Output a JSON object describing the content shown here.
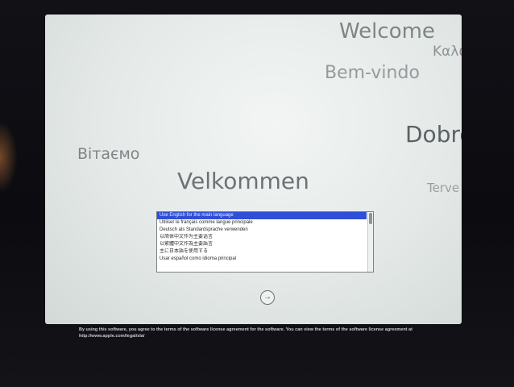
{
  "welcome_words": {
    "welcome": "Welcome",
    "greek": "Καλώ",
    "portuguese": "Bem-vindo",
    "croatian": "Dobro",
    "belarusian": "Вітаємо",
    "norwegian": "Velkommen",
    "finnish": "Terve"
  },
  "language_list": {
    "items": [
      {
        "label": "Use English for the main language",
        "selected": true
      },
      {
        "label": "Utiliser le français comme langue principale",
        "selected": false
      },
      {
        "label": "Deutsch als Standardsprache verwenden",
        "selected": false
      },
      {
        "label": "以简体中文作为主要语言",
        "selected": false
      },
      {
        "label": "以繁體中文作為主要語言",
        "selected": false
      },
      {
        "label": "主に日本語を使用する",
        "selected": false
      },
      {
        "label": "Usar español como idioma principal",
        "selected": false
      }
    ]
  },
  "continue_icon": "→",
  "license": {
    "text": "By using this software, you agree to the terms of the software license agreement for the software. You can view the terms of the software license agreement at",
    "link": "http://www.apple.com/legal/sla/"
  },
  "colors": {
    "selection": "#2f4fd6",
    "screen_background": "#e4e9e7",
    "bezel": "#0f0f14"
  }
}
